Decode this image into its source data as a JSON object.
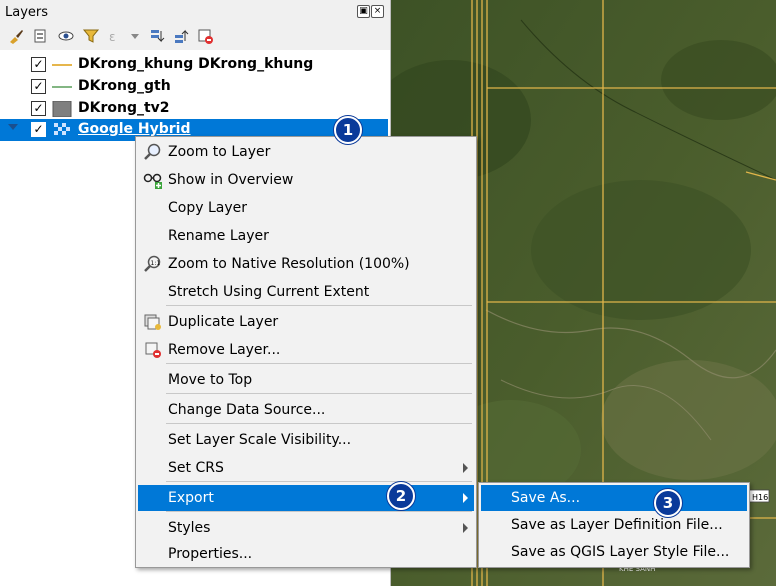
{
  "panel": {
    "title": "Layers"
  },
  "toolbar": {
    "icons": [
      "paintbrush-icon",
      "add-group-icon",
      "eye-icon",
      "filter-icon",
      "expression-icon",
      "expand-all-icon",
      "collapse-all-icon",
      "remove-layer-icon"
    ]
  },
  "layers": [
    {
      "label": "DKrong_khung DKrong_khung",
      "checked": true,
      "icon": "line-symbol-icon",
      "color": "#e6b64c"
    },
    {
      "label": "DKrong_gth",
      "checked": true,
      "icon": "line-symbol-icon",
      "color": "#5a9e5a"
    },
    {
      "label": "DKrong_tv2",
      "checked": true,
      "icon": "fill-symbol-icon",
      "color": "#7f7f7f"
    },
    {
      "label": "Google Hybrid",
      "checked": true,
      "icon": "raster-icon",
      "selected": true
    }
  ],
  "context_menu": {
    "items": [
      {
        "label": "Zoom to Layer"
      },
      {
        "label": "Show in Overview"
      },
      {
        "label": "Copy Layer"
      },
      {
        "label": "Rename Layer"
      },
      {
        "label": "Zoom to Native Resolution (100%)"
      },
      {
        "label": "Stretch Using Current Extent"
      },
      {
        "label": "Duplicate Layer"
      },
      {
        "label": "Remove Layer..."
      },
      {
        "label": "Move to Top"
      },
      {
        "label": "Change Data Source..."
      },
      {
        "label": "Set Layer Scale Visibility..."
      },
      {
        "label": "Set CRS"
      },
      {
        "label": "Export"
      },
      {
        "label": "Styles"
      },
      {
        "label": "Properties..."
      }
    ]
  },
  "export_submenu": {
    "items": [
      {
        "label": "Save As..."
      },
      {
        "label": "Save as Layer Definition File..."
      },
      {
        "label": "Save as QGIS Layer Style File..."
      }
    ]
  },
  "badges": [
    "1",
    "2",
    "3"
  ],
  "map": {
    "labels": [
      "H16",
      "KHE SANH"
    ]
  },
  "colors": {
    "accent": "#0078d7",
    "badge": "#0a3a9a",
    "grid": "#e0b54a"
  }
}
